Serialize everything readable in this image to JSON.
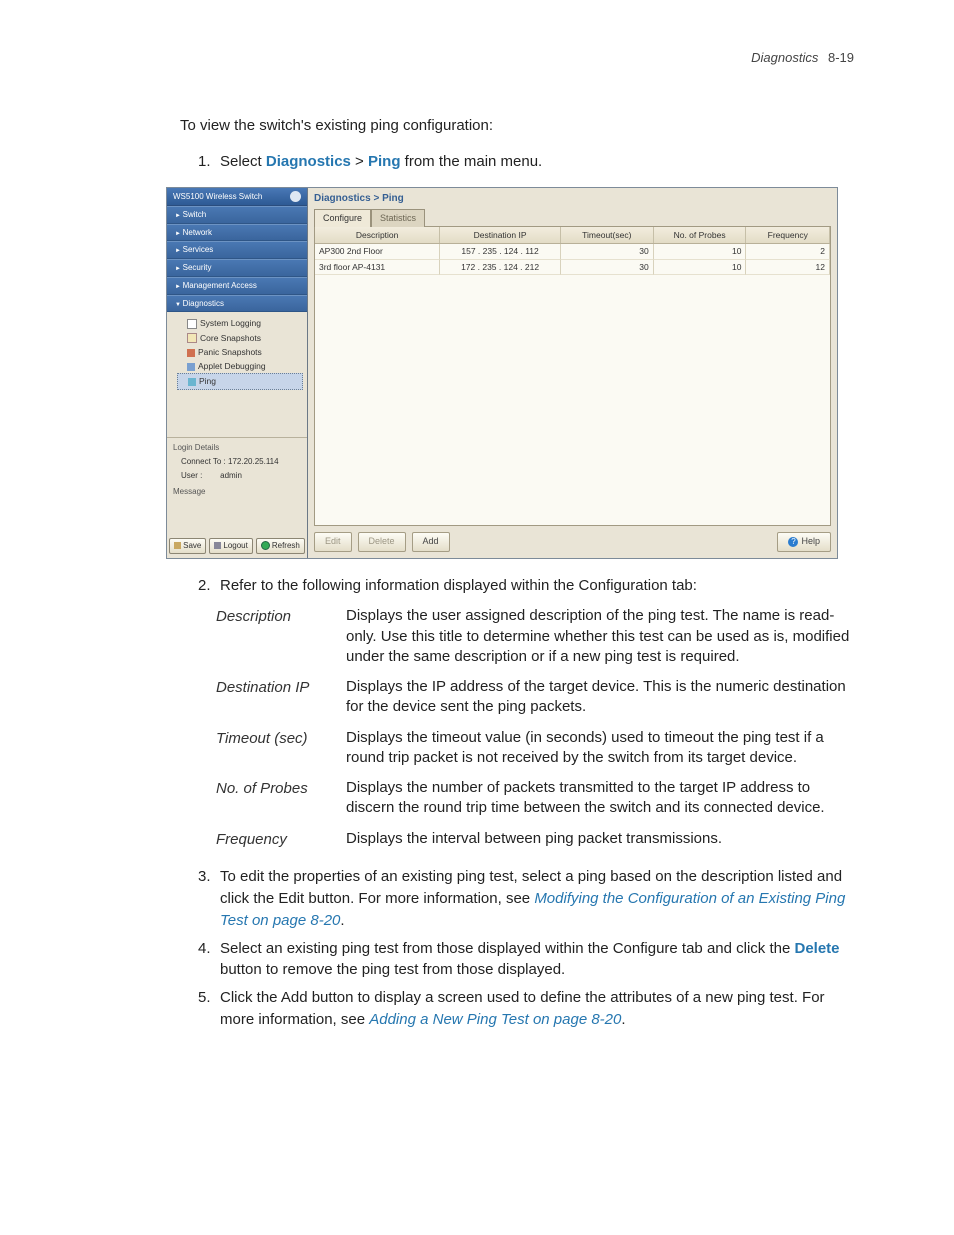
{
  "header": {
    "section": "Diagnostics",
    "page": "8-19"
  },
  "intro": "To view the switch's existing ping configuration:",
  "step1": {
    "num": "1.",
    "pre": "Select ",
    "kw1": "Diagnostics",
    "sep": " > ",
    "kw2": "Ping",
    "post": " from the main menu."
  },
  "screenshot": {
    "brand": "WS5100 Wireless Switch",
    "nav": {
      "switch": "Switch",
      "network": "Network",
      "services": "Services",
      "security": "Security",
      "mgmt": "Management Access",
      "diag": "Diagnostics"
    },
    "tree": {
      "syslog": "System Logging",
      "core": "Core Snapshots",
      "panic": "Panic Snapshots",
      "applet": "Applet Debugging",
      "ping": "Ping"
    },
    "login": {
      "title": "Login Details",
      "connect_label": "Connect To :",
      "connect_val": "172.20.25.114",
      "user_label": "User :",
      "user_val": "admin",
      "message": "Message"
    },
    "sidebar_buttons": {
      "save": "Save",
      "logout": "Logout",
      "refresh": "Refresh"
    },
    "crumb": "Diagnostics > Ping",
    "tabs": {
      "configure": "Configure",
      "statistics": "Statistics"
    },
    "columns": {
      "desc": "Description",
      "dest": "Destination IP",
      "timeout": "Timeout(sec)",
      "probes": "No. of Probes",
      "freq": "Frequency"
    },
    "rows": [
      {
        "desc": "AP300 2nd Floor",
        "dest": "157  .  235  .  124  .  112",
        "timeout": "30",
        "probes": "10",
        "freq": "2"
      },
      {
        "desc": "3rd floor AP-4131",
        "dest": "172  .  235  .  124  .  212",
        "timeout": "30",
        "probes": "10",
        "freq": "12"
      }
    ],
    "buttons": {
      "edit": "Edit",
      "delete": "Delete",
      "add": "Add",
      "help": "Help"
    }
  },
  "step2": {
    "num": "2.",
    "text": "Refer to the following information displayed within the Configuration tab:"
  },
  "defs": {
    "description": {
      "term": "Description",
      "desc": "Displays the user assigned description of the ping test. The name is read-only. Use this title to determine whether this test can be used as is, modified under the same description or if a new ping test is required."
    },
    "destip": {
      "term": "Destination IP",
      "desc": "Displays the IP address of the target device. This is the numeric destination for the device sent the ping packets."
    },
    "timeout": {
      "term": "Timeout (sec)",
      "desc": "Displays the timeout value (in seconds) used to timeout the ping test if a round trip packet is not received by the switch from its target device."
    },
    "probes": {
      "term": "No. of Probes",
      "desc": "Displays the number of packets transmitted to the target IP address to discern the round trip time between the switch and its connected device."
    },
    "frequency": {
      "term": "Frequency",
      "desc": "Displays the interval between ping packet transmissions."
    }
  },
  "step3": {
    "num": "3.",
    "text_a": "To edit the properties of an existing ping test, select a ping based on the description listed and click the Edit button. For more information, see ",
    "link": "Modifying the Configuration of an Existing Ping Test on page 8-20",
    "text_b": "."
  },
  "step4": {
    "num": "4.",
    "text_a": "Select an existing ping test from those displayed within the Configure tab and click the ",
    "kw": "Delete",
    "text_b": " button to remove the ping test from those displayed."
  },
  "step5": {
    "num": "5.",
    "text_a": "Click the Add button to display a screen used to define the attributes of a new ping test. For more information, see ",
    "link": "Adding a New Ping Test on page 8-20",
    "text_b": "."
  }
}
